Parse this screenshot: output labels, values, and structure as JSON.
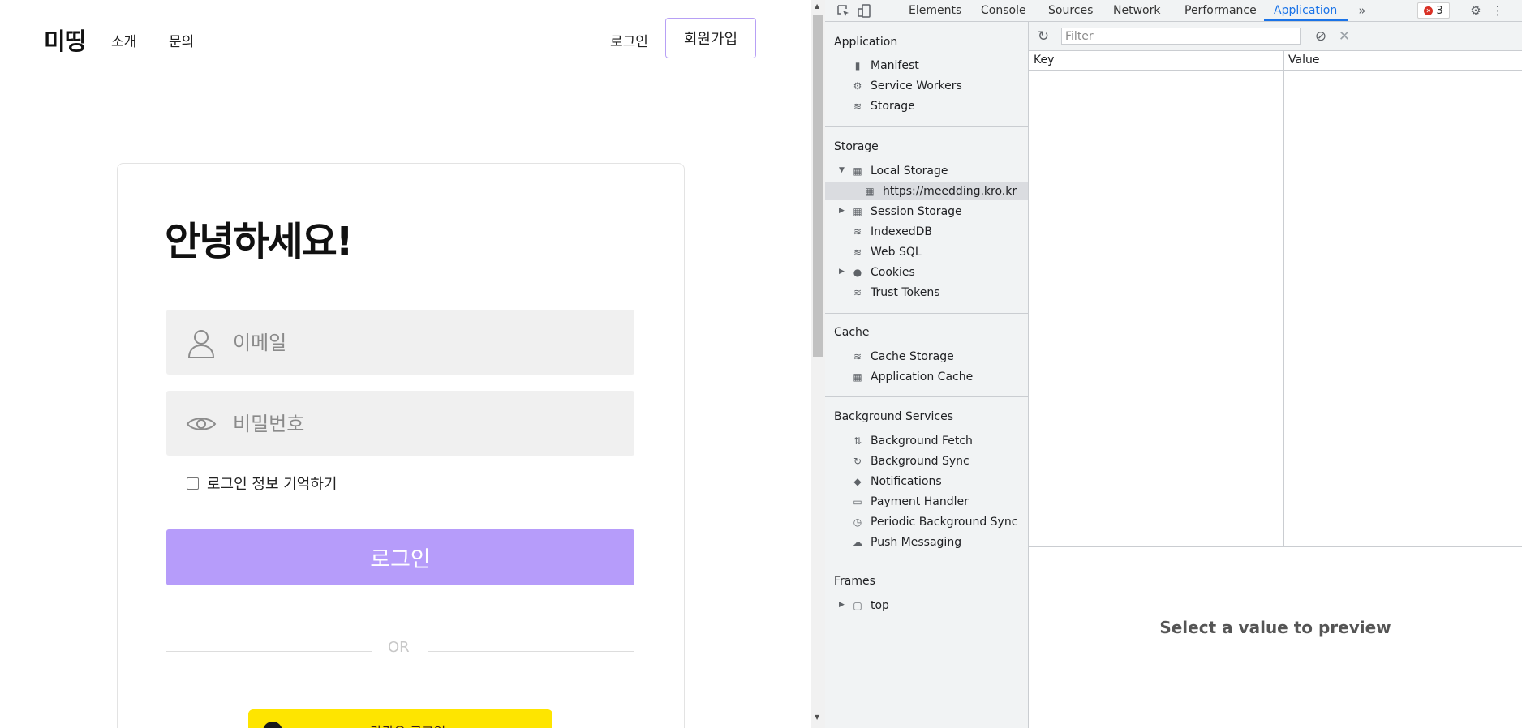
{
  "site": {
    "logo": "미띵",
    "nav": [
      "소개",
      "문의"
    ],
    "login_link": "로그인",
    "signup_button": "회원가입",
    "greeting": "안녕하세요!",
    "email_placeholder": "이메일",
    "password_placeholder": "비밀번호",
    "remember_label": "로그인 정보 기억하기",
    "login_button": "로그인",
    "or_text": "OR",
    "kakao_label": "카카오 로그인"
  },
  "devtools": {
    "tabs": [
      "Elements",
      "Console",
      "Sources",
      "Network",
      "Performance",
      "Application"
    ],
    "active_tab": "Application",
    "more_tabs_icon": "chevron-double-right-icon",
    "error_count": "3",
    "sidebar": {
      "application_header": "Application",
      "application_items": [
        "Manifest",
        "Service Workers",
        "Storage"
      ],
      "storage_header": "Storage",
      "storage_items": [
        "Local Storage",
        "https://meedding.kro.kr",
        "Session Storage",
        "IndexedDB",
        "Web SQL",
        "Cookies",
        "Trust Tokens"
      ],
      "cache_header": "Cache",
      "cache_items": [
        "Cache Storage",
        "Application Cache"
      ],
      "background_header": "Background Services",
      "background_items": [
        "Background Fetch",
        "Background Sync",
        "Notifications",
        "Payment Handler",
        "Periodic Background Sync",
        "Push Messaging"
      ],
      "frames_header": "Frames",
      "frames_items": [
        "top"
      ]
    },
    "filter_placeholder": "Filter",
    "columns": [
      "Key",
      "Value"
    ],
    "preview_text": "Select a value to preview",
    "accent_color": "#1a73e8"
  }
}
